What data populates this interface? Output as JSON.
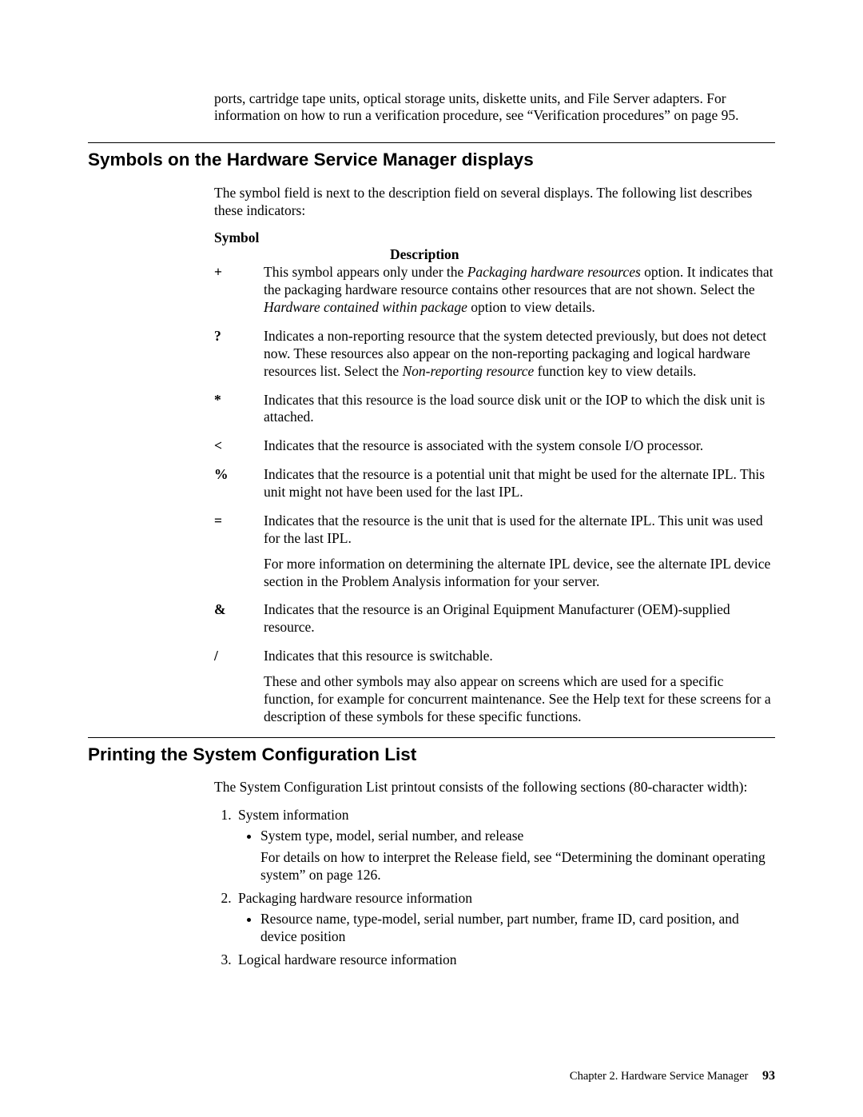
{
  "intro": "ports, cartridge tape units, optical storage units, diskette units, and File Server adapters. For information on how to run a verification procedure, see “Verification procedures” on page 95.",
  "section1": {
    "heading": "Symbols on the Hardware Service Manager displays",
    "lead": "The symbol field is next to the description field on several displays. The following list describes these indicators:",
    "dl_term_label": "Symbol",
    "dl_desc_label": "Description",
    "symbols": {
      "plus": {
        "sym": "+",
        "p1a": "This symbol appears only under the ",
        "p1b_i": "Packaging hardware resources",
        "p1c": " option. It indicates that the packaging hardware resource contains other resources that are not shown. Select the ",
        "p1d_i": "Hardware contained within package",
        "p1e": " option to view details."
      },
      "quest": {
        "sym": "?",
        "p1a": "Indicates a non-reporting resource that the system detected previously, but does not detect now. These resources also appear on the non-reporting packaging and logical hardware resources list. Select the ",
        "p1b_i": "Non-reporting resource",
        "p1c": " function key to view details."
      },
      "star": {
        "sym": "*",
        "p1": "Indicates that this resource is the load source disk unit or the IOP to which the disk unit is attached."
      },
      "lt": {
        "sym": "<",
        "p1": "Indicates that the resource is associated with the system console I/O processor."
      },
      "pct": {
        "sym": "%",
        "p1": "Indicates that the resource is a potential unit that might be used for the alternate IPL. This unit might not have been used for the last IPL."
      },
      "eq": {
        "sym": "=",
        "p1": "Indicates that the resource is the unit that is used for the alternate IPL. This unit was used for the last IPL.",
        "p2": "For more information on determining the alternate IPL device, see the alternate IPL device section in the Problem Analysis information for your server."
      },
      "amp": {
        "sym": "&",
        "p1": "Indicates that the resource is an Original Equipment Manufacturer (OEM)-supplied resource."
      },
      "slash": {
        "sym": "/",
        "p1": "Indicates that this resource is switchable.",
        "p2": "These and other symbols may also appear on screens which are used for a specific function, for example for concurrent maintenance. See the Help text for these screens for a description of these symbols for these specific functions."
      }
    }
  },
  "section2": {
    "heading": "Printing the System Configuration List",
    "lead": "The System Configuration List printout consists of the following sections (80-character width):",
    "items": {
      "i1": {
        "label": "System information",
        "b1": "System type, model, serial number, and release",
        "b1_note": "For details on how to interpret the Release field, see “Determining the dominant operating system” on page 126."
      },
      "i2": {
        "label": "Packaging hardware resource information",
        "b1": "Resource name, type-model, serial number, part number, frame ID, card position, and device position"
      },
      "i3": {
        "label": "Logical hardware resource information"
      }
    }
  },
  "footer": {
    "chapter": "Chapter 2. Hardware Service Manager",
    "page": "93"
  }
}
